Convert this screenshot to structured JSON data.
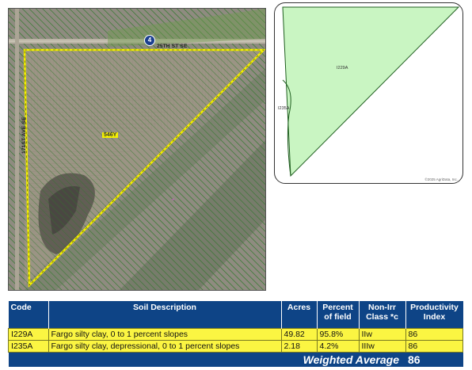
{
  "aerial_map": {
    "road_shield": "4",
    "road_north": "25TH ST SE",
    "road_west": "171ST AVE SE",
    "field_label": "546Y",
    "field_line_color": "#f4f100",
    "hatch_color": "#2e7a2a"
  },
  "inset_map": {
    "label_main": "I229A",
    "label_edge": "I235A",
    "copyright": "©2025 AgriData, Inc.",
    "soil_fill_color": "#c9f5c2"
  },
  "soil_table": {
    "headers": {
      "code": "Code",
      "description": "Soil Description",
      "acres": "Acres",
      "percent_1": "Percent",
      "percent_2": "of field",
      "nonirr_1": "Non-Irr",
      "nonirr_2": "Class *c",
      "prod_1": "Productivity",
      "prod_2": "Index"
    },
    "rows": [
      {
        "code": "I229A",
        "description": "Fargo silty clay, 0 to 1 percent slopes",
        "acres": "49.82",
        "percent": "95.8%",
        "class": "IIw",
        "index": "86"
      },
      {
        "code": "I235A",
        "description": "Fargo silty clay, depressional, 0 to 1 percent slopes",
        "acres": "2.18",
        "percent": "4.2%",
        "class": "IIIw",
        "index": "86"
      }
    ],
    "weighted_average_label": "Weighted Average",
    "weighted_average_value": "86"
  }
}
